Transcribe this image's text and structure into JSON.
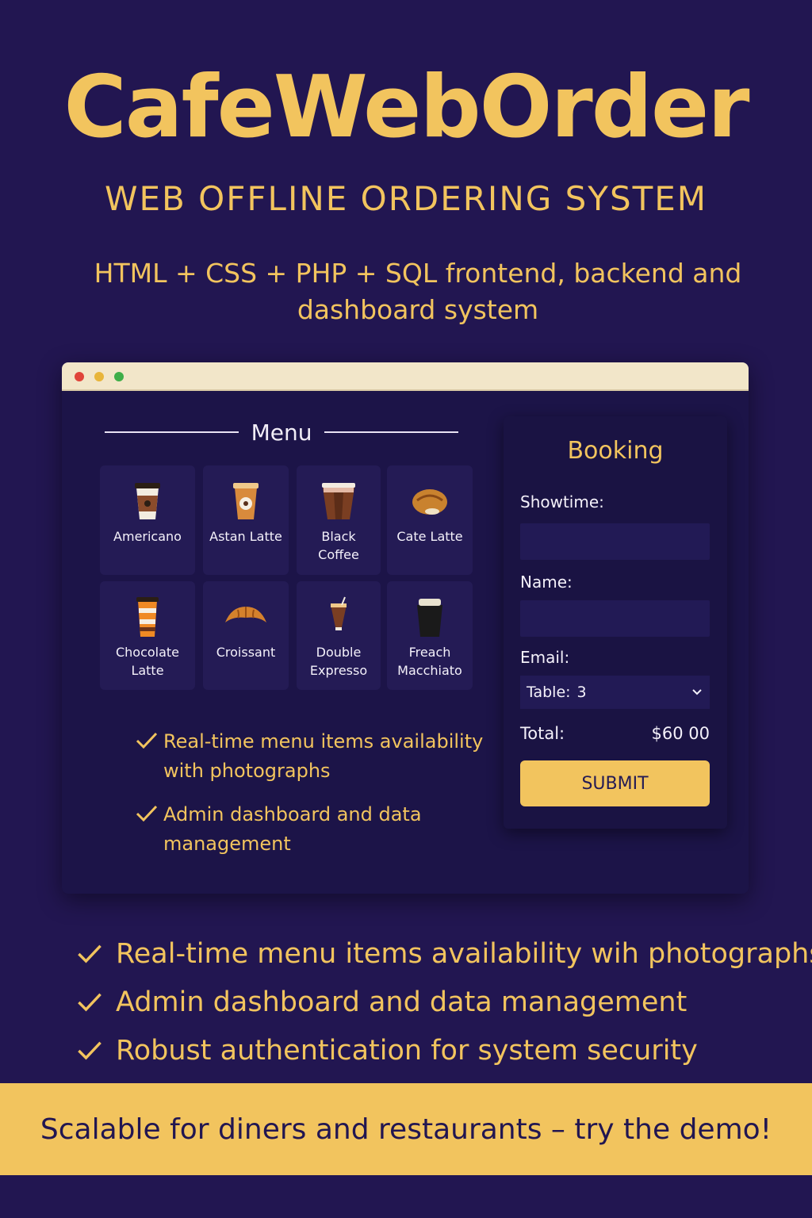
{
  "header": {
    "title": "CafeWebOrder",
    "subtitle": "WEB OFFLINE ORDERING SYSTEM",
    "tech": "HTML + CSS + PHP + SQL frontend, backend and dashboard system"
  },
  "colors": {
    "background": "#221651",
    "accent": "#f2c45e",
    "panel": "#1c1448",
    "titlebar": "#f2e6c9"
  },
  "menu": {
    "heading": "Menu",
    "items": [
      {
        "label": "Americano",
        "icon": "americano-cup-icon"
      },
      {
        "label": "Astan Latte",
        "icon": "latte-cup-icon"
      },
      {
        "label": "Black Coffee",
        "icon": "black-coffee-cup-icon"
      },
      {
        "label": "Cate Latte",
        "icon": "pastry-icon"
      },
      {
        "label": "Chocolate Latte",
        "icon": "chocolate-latte-cup-icon"
      },
      {
        "label": "Croissant",
        "icon": "croissant-icon"
      },
      {
        "label": "Double Expresso",
        "icon": "espresso-glass-icon"
      },
      {
        "label": "Freach Macchiato",
        "icon": "macchiato-cup-icon"
      }
    ]
  },
  "features": [
    "Real-time menu items availability with photographs",
    "Admin dashboard  and data management"
  ],
  "booking": {
    "title": "Booking",
    "showtime_label": "Showtime:",
    "showtime_value": "",
    "name_label": "Name:",
    "name_value": "",
    "email_label": "Email:",
    "table_label": "Table:",
    "table_value": "3",
    "total_label": "Total:",
    "total_value": "$60 00",
    "submit_label": "SUBMIT"
  },
  "bottom_features": [
    "Real-time menu items availability wih photographs",
    "Admin dashboard and data management",
    "Robust authentication for system security"
  ],
  "banner": "Scalable for diners and restaurants – try the demo!"
}
